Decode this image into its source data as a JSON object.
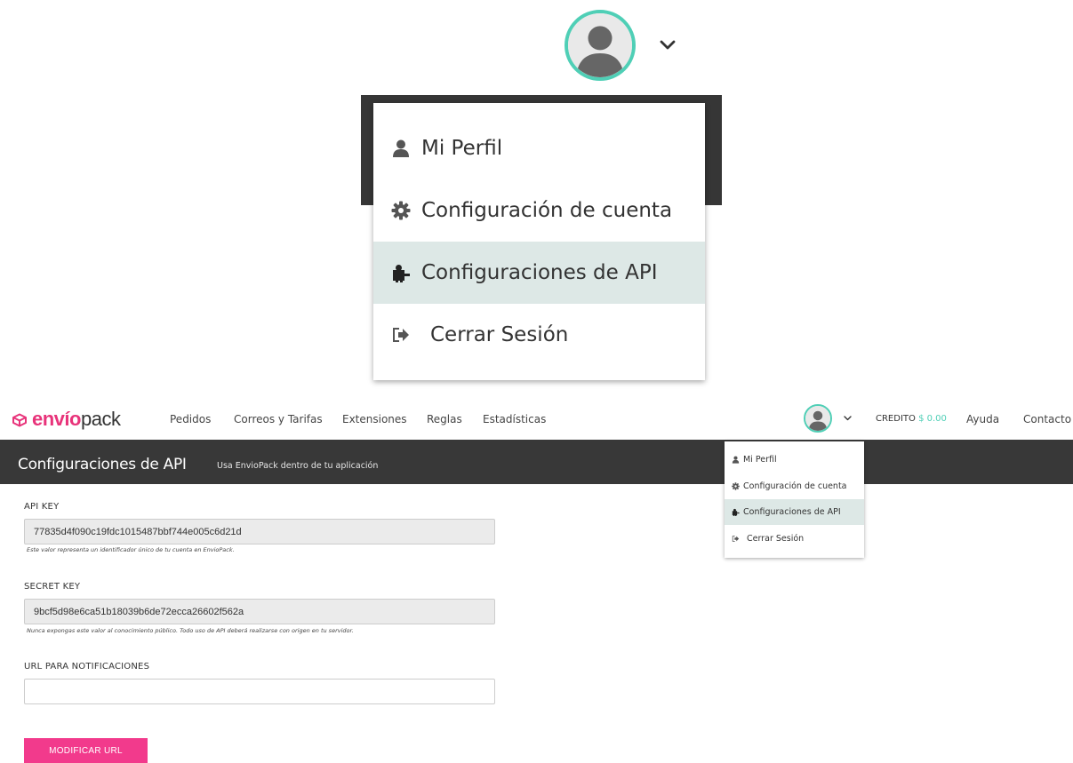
{
  "zoom": {
    "avatar_icon": "user-avatar-icon",
    "menu": [
      {
        "label": "Mi Perfil",
        "icon": "user-icon",
        "active": false
      },
      {
        "label": "Configuración de cuenta",
        "icon": "gear-icon",
        "active": false
      },
      {
        "label": "Configuraciones de API",
        "icon": "puzzle-icon",
        "active": true
      },
      {
        "label": "Cerrar Sesión",
        "icon": "sign-out-icon",
        "active": false
      }
    ]
  },
  "nav": {
    "logo": {
      "bold": "envío",
      "light": "pack"
    },
    "links": [
      "Pedidos",
      "Correos y Tarifas",
      "Extensiones",
      "Reglas",
      "Estadísticas"
    ],
    "credit_label": "CREDITO",
    "credit_amount": "$ 0.00",
    "help": "Ayuda",
    "contact": "Contacto"
  },
  "header": {
    "title": "Configuraciones de API",
    "subtitle": "Usa EnvioPack dentro de tu aplicación"
  },
  "dropdown": {
    "items": [
      {
        "label": "Mi Perfil",
        "icon": "user-icon",
        "active": false
      },
      {
        "label": "Configuración de cuenta",
        "icon": "gear-icon",
        "active": false
      },
      {
        "label": "Configuraciones de API",
        "icon": "puzzle-icon",
        "active": true
      },
      {
        "label": "Cerrar Sesión",
        "icon": "sign-out-icon",
        "active": false
      }
    ]
  },
  "form": {
    "api_key": {
      "label": "API KEY",
      "value": "77835d4f090c19fdc1015487bbf744e005c6d21d",
      "help": "Este valor representa un identificador único de tu cuenta en EnvioPack."
    },
    "secret_key": {
      "label": "SECRET KEY",
      "value": "9bcf5d98e6ca51b18039b6de72ecca26602f562a",
      "help": "Nunca expongas este valor al conocimiento público. Todo uso de API deberá realizarse con origen en tu servidor."
    },
    "notification_url": {
      "label": "URL PARA NOTIFICACIONES",
      "value": ""
    },
    "submit_label": "MODIFICAR URL"
  },
  "colors": {
    "brand_pink": "#e8337a",
    "button_pink": "#f23a8c",
    "teal_accent": "#4fcfb6",
    "header_dark": "#383838",
    "active_item_bg": "#dde8e6"
  }
}
